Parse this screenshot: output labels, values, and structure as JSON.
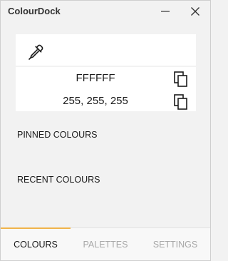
{
  "window": {
    "title": "ColourDock",
    "minimize_icon": "minimize-icon",
    "close_icon": "close-icon"
  },
  "picker": {
    "eyedropper_icon": "eyedropper-icon",
    "hex_value": "FFFFFF",
    "rgb_value": "255, 255, 255",
    "copy_icon": "copy-icon"
  },
  "sections": {
    "pinned_label": "PINNED COLOURS",
    "recent_label": "RECENT COLOURS"
  },
  "nav": {
    "tabs": [
      {
        "label": "COLOURS",
        "active": true
      },
      {
        "label": "PALETTES",
        "active": false
      },
      {
        "label": "SETTINGS",
        "active": false
      }
    ]
  },
  "colors": {
    "accent": "#f0b34a",
    "inactive_tab": "#a8a8a8",
    "background": "#f2f2f2",
    "card": "#ffffff"
  }
}
